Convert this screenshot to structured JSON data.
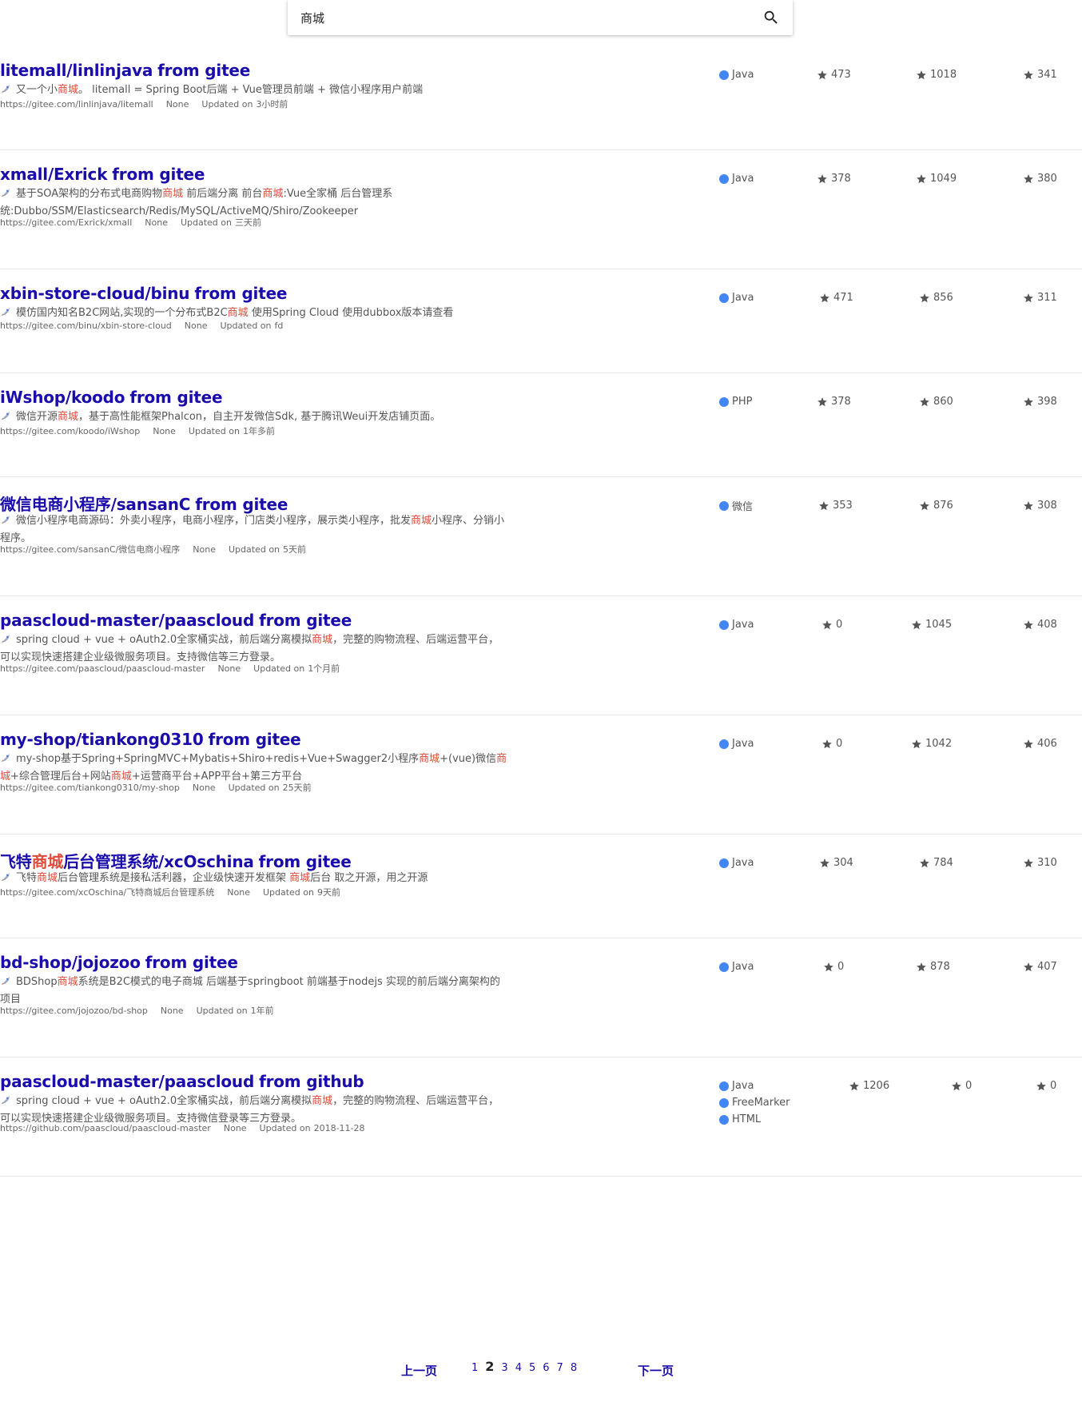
{
  "search": {
    "query": "商城"
  },
  "labels": {
    "from_prefix": "from",
    "updated_prefix": "Updated on",
    "license": "None"
  },
  "results": [
    {
      "title_parts": [
        "litemall/linlinjava"
      ],
      "source": "gitee",
      "desc_parts": [
        [
          "又一个小",
          false
        ],
        [
          "商城",
          true
        ],
        [
          "。 litemall = Spring Boot后端 + Vue管理员前端 + 微信小程序用户前端",
          false
        ]
      ],
      "url": "https://gitee.com/linlinjava/litemall",
      "license": "None",
      "updated": "3小时前",
      "languages": [
        "Java"
      ],
      "stats": [
        "473",
        "1018",
        "341"
      ]
    },
    {
      "title_parts": [
        "xmall/Exrick"
      ],
      "source": "gitee",
      "desc_parts": [
        [
          "基于SOA架构的分布式电商购物",
          false
        ],
        [
          "商城",
          true
        ],
        [
          " 前后端分离 前台",
          false
        ],
        [
          "商城",
          true
        ],
        [
          ":Vue全家桶 后台管理系统:Dubbo/SSM/Elasticsearch/Redis/MySQL/ActiveMQ/Shiro/Zookeeper",
          false
        ]
      ],
      "url": "https://gitee.com/Exrick/xmall",
      "license": "None",
      "updated": "三天前",
      "languages": [
        "Java"
      ],
      "stats": [
        "378",
        "1049",
        "380"
      ]
    },
    {
      "title_parts": [
        "xbin-store-cloud/binu"
      ],
      "source": "gitee",
      "desc_parts": [
        [
          "模仿国内知名B2C网站,实现的一个分布式B2C",
          false
        ],
        [
          "商城",
          true
        ],
        [
          " 使用Spring Cloud 使用dubbox版本请查看",
          false
        ]
      ],
      "url": "https://gitee.com/binu/xbin-store-cloud",
      "license": "None",
      "updated": "fd",
      "languages": [
        "Java"
      ],
      "stats": [
        "471",
        "856",
        "311"
      ]
    },
    {
      "title_parts": [
        "iWshop/koodo"
      ],
      "source": "gitee",
      "desc_parts": [
        [
          "微信开源",
          false
        ],
        [
          "商城",
          true
        ],
        [
          "，基于高性能框架Phalcon，自主开发微信Sdk, 基于腾讯Weui开发店铺页面。",
          false
        ]
      ],
      "url": "https://gitee.com/koodo/iWshop",
      "license": "None",
      "updated": "1年多前",
      "languages": [
        "PHP"
      ],
      "stats": [
        "378",
        "860",
        "398"
      ]
    },
    {
      "title_parts": [
        "微信电商小程序/sansanC"
      ],
      "source": "gitee",
      "desc_parts": [
        [
          "微信小程序电商源码：外卖小程序，电商小程序，门店类小程序，展示类小程序，批发",
          false
        ],
        [
          "商城",
          true
        ],
        [
          "小程序、分销小程序。",
          false
        ]
      ],
      "url": "https://gitee.com/sansanC/微信电商小程序",
      "license": "None",
      "updated": "5天前",
      "languages": [
        "微信"
      ],
      "stats": [
        "353",
        "876",
        "308"
      ]
    },
    {
      "title_parts": [
        "paascloud-master/paascloud"
      ],
      "source": "gitee",
      "desc_parts": [
        [
          "spring cloud + vue + oAuth2.0全家桶实战，前后端分离模拟",
          false
        ],
        [
          "商城",
          true
        ],
        [
          "，完整的购物流程、后端运营平台，可以实现快速搭建企业级微服务项目。支持微信等三方登录。",
          false
        ]
      ],
      "url": "https://gitee.com/paascloud/paascloud-master",
      "license": "None",
      "updated": "1个月前",
      "languages": [
        "Java"
      ],
      "stats": [
        "0",
        "1045",
        "408"
      ]
    },
    {
      "title_parts": [
        "my-shop/tiankong0310"
      ],
      "source": "gitee",
      "desc_parts": [
        [
          "my-shop基于Spring+SpringMVC+Mybatis+Shiro+redis+Vue+Swagger2小程序",
          false
        ],
        [
          "商城",
          true
        ],
        [
          "+(vue)微信",
          false
        ],
        [
          "商城",
          true
        ],
        [
          "+综合管理后台+网站",
          false
        ],
        [
          "商城",
          true
        ],
        [
          "+运营商平台+APP平台+第三方平台",
          false
        ]
      ],
      "url": "https://gitee.com/tiankong0310/my-shop",
      "license": "None",
      "updated": "25天前",
      "languages": [
        "Java"
      ],
      "stats": [
        "0",
        "1042",
        "406"
      ]
    },
    {
      "title_parts": [
        "飞特",
        "商城",
        "后台管理系统/xcOschina"
      ],
      "source": "gitee",
      "desc_parts": [
        [
          "飞特",
          false
        ],
        [
          "商城",
          true
        ],
        [
          "后台管理系统是接私活利器，企业级快速开发框架 ",
          false
        ],
        [
          "商城",
          true
        ],
        [
          "后台 取之开源，用之开源",
          false
        ]
      ],
      "url": "https://gitee.com/xcOschina/飞特商城后台管理系统",
      "license": "None",
      "updated": "9天前",
      "languages": [
        "Java"
      ],
      "stats": [
        "304",
        "784",
        "310"
      ]
    },
    {
      "title_parts": [
        "bd-shop/jojozoo"
      ],
      "source": "gitee",
      "desc_parts": [
        [
          "BDShop",
          false
        ],
        [
          "商城",
          true
        ],
        [
          "系统是B2C模式的电子商城 后端基于springboot 前端基于nodejs 实现的前后端分离架构的项目",
          false
        ]
      ],
      "url": "https://gitee.com/jojozoo/bd-shop",
      "license": "None",
      "updated": "1年前",
      "languages": [
        "Java"
      ],
      "stats": [
        "0",
        "878",
        "407"
      ]
    },
    {
      "title_parts": [
        "paascloud-master/paascloud"
      ],
      "source": "github",
      "desc_parts": [
        [
          "spring cloud + vue + oAuth2.0全家桶实战，前后端分离模拟",
          false
        ],
        [
          "商城",
          true
        ],
        [
          "，完整的购物流程、后端运营平台，可以实现快速搭建企业级微服务项目。支持微信登录等三方登录。",
          false
        ]
      ],
      "url": "https://github.com/paascloud/paascloud-master",
      "license": "None",
      "updated": "2018-11-28",
      "languages": [
        "Java",
        "FreeMarker",
        "HTML"
      ],
      "stats": [
        "1206",
        "0",
        "0"
      ]
    }
  ],
  "pagination": {
    "prev_label": "上一页",
    "next_label": "下一页",
    "pages": [
      "1",
      "2",
      "3",
      "4",
      "5",
      "6",
      "7",
      "8"
    ],
    "current": "2"
  }
}
